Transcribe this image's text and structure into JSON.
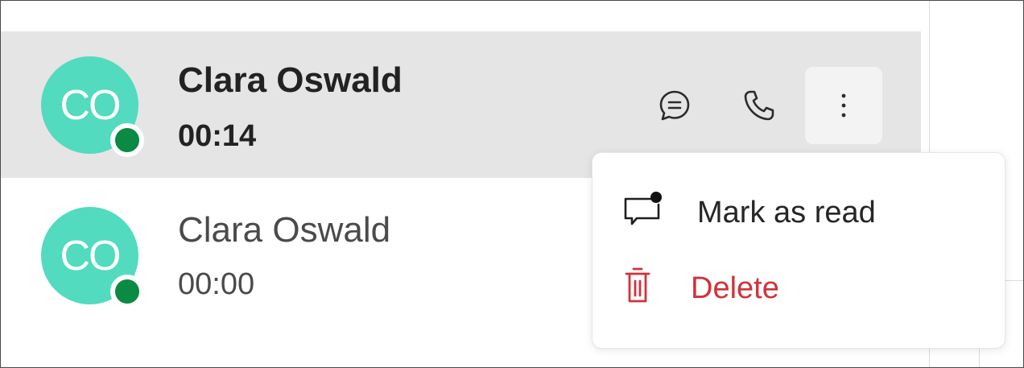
{
  "conversations": [
    {
      "initials": "CO",
      "name": "Clara Oswald",
      "time": "00:14",
      "state": "selected-unread",
      "presence": "online"
    },
    {
      "initials": "CO",
      "name": "Clara Oswald",
      "time": "00:00",
      "state": "read",
      "presence": "online"
    }
  ],
  "row_actions": {
    "message_icon": "chat-bubble-icon",
    "call_icon": "phone-icon",
    "more_icon": "more-vertical-icon"
  },
  "context_menu": {
    "items": [
      {
        "label": "Mark as read",
        "icon": "mark-read-icon"
      },
      {
        "label": "Delete",
        "icon": "trash-icon",
        "color": "#d2323a"
      }
    ]
  },
  "colors": {
    "avatar": "#52dbbe",
    "presence": "#0a8a43",
    "selected_row": "#e5e5e5",
    "danger": "#d2323a"
  }
}
